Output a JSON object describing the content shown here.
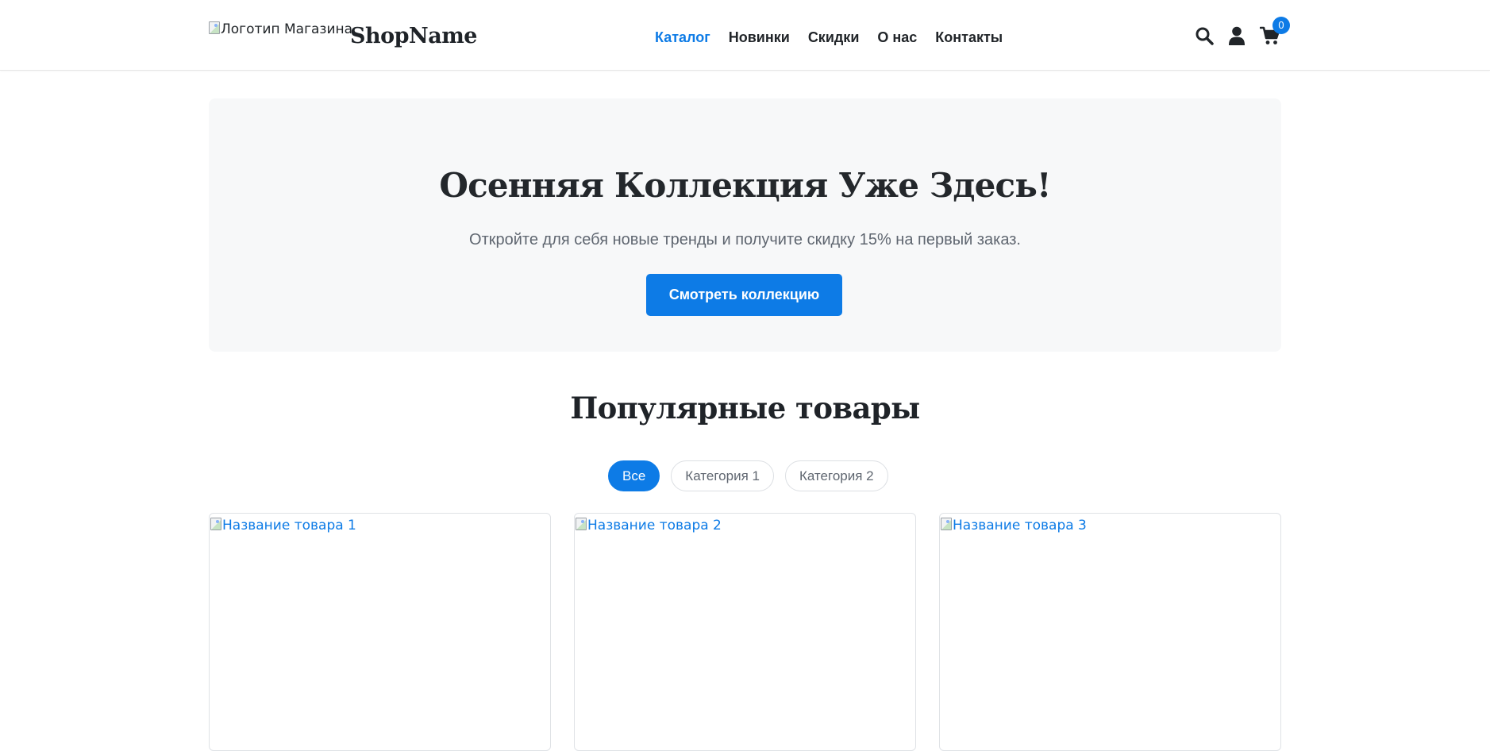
{
  "header": {
    "logo_alt": "Логотип Магазина",
    "brand": "ShopName",
    "nav": [
      {
        "label": "Каталог",
        "active": true
      },
      {
        "label": "Новинки",
        "active": false
      },
      {
        "label": "Скидки",
        "active": false
      },
      {
        "label": "О нас",
        "active": false
      },
      {
        "label": "Контакты",
        "active": false
      }
    ],
    "icons": [
      "search-icon",
      "user-icon",
      "cart-icon"
    ],
    "cart_count": "0"
  },
  "hero": {
    "title": "Осенняя Коллекция Уже Здесь!",
    "subtitle": "Откройте для себя новые тренды и получите скидку 15% на первый заказ.",
    "button_label": "Смотреть коллекцию"
  },
  "popular": {
    "title": "Популярные товары",
    "filters": [
      {
        "label": "Все",
        "active": true
      },
      {
        "label": "Категория 1",
        "active": false
      },
      {
        "label": "Категория 2",
        "active": false
      }
    ],
    "products": [
      {
        "image_alt": "Название товара 1"
      },
      {
        "image_alt": "Название товара 2"
      },
      {
        "image_alt": "Название товара 3"
      }
    ]
  },
  "colors": {
    "accent": "#0d7be6",
    "hero_bg": "#f7f8f9",
    "text": "#212529",
    "muted": "#5f6670"
  }
}
